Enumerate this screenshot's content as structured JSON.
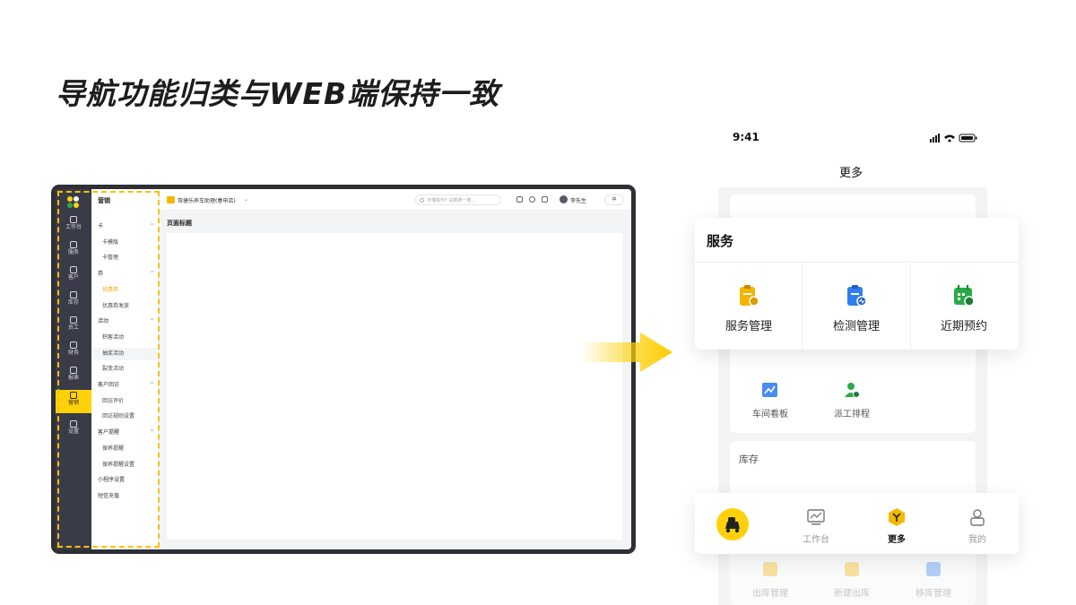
{
  "headline": "导航功能归类与WEB端保持一致",
  "web": {
    "rail": [
      {
        "label": "工作台",
        "icon": "workbench-icon"
      },
      {
        "label": "服务",
        "icon": "service-icon"
      },
      {
        "label": "客户",
        "icon": "customer-icon"
      },
      {
        "label": "库存",
        "icon": "inventory-icon"
      },
      {
        "label": "员工",
        "icon": "staff-icon"
      },
      {
        "label": "财务",
        "icon": "finance-icon"
      },
      {
        "label": "报表",
        "icon": "report-icon"
      },
      {
        "label": "营销",
        "icon": "marketing-icon",
        "active": true
      },
      {
        "label": "设置",
        "icon": "settings-icon"
      }
    ],
    "submenu": {
      "title": "营销",
      "rows": [
        {
          "label": "卡",
          "type": "group",
          "caret": "^"
        },
        {
          "label": "卡模版",
          "type": "child"
        },
        {
          "label": "卡管理",
          "type": "child"
        },
        {
          "label": "券",
          "type": "group",
          "caret": "^"
        },
        {
          "label": "优惠券",
          "type": "child",
          "active": true
        },
        {
          "label": "优惠券发放",
          "type": "child"
        },
        {
          "label": "活动",
          "type": "group",
          "caret": "^"
        },
        {
          "label": "积客活动",
          "type": "child"
        },
        {
          "label": "抽奖活动",
          "type": "child",
          "hover": true
        },
        {
          "label": "裂变活动",
          "type": "child"
        },
        {
          "label": "客户回访",
          "type": "group",
          "caret": "^"
        },
        {
          "label": "回访评价",
          "type": "child"
        },
        {
          "label": "回访规则设置",
          "type": "child"
        },
        {
          "label": "客户提醒",
          "type": "group",
          "caret": "^"
        },
        {
          "label": "保养提醒",
          "type": "child"
        },
        {
          "label": "保养提醒设置",
          "type": "child"
        },
        {
          "label": "小程序设置",
          "type": "group"
        },
        {
          "label": "短信充值",
          "type": "group"
        }
      ]
    },
    "topbar": {
      "shop": "驾捷乐养车助理(春申店)",
      "search_placeholder": "不懂操作? 试着搜一搜...",
      "user": "李先生",
      "lang": "中"
    },
    "page_title": "页面标题"
  },
  "phone": {
    "time": "9:41",
    "title": "更多",
    "services": {
      "title": "服务",
      "items": [
        {
          "label": "服务管理",
          "icon": "service-management-icon",
          "color": "#f5b400"
        },
        {
          "label": "检测管理",
          "icon": "inspection-management-icon",
          "color": "#2f7ff0"
        },
        {
          "label": "近期预约",
          "icon": "recent-appointment-icon",
          "color": "#2aa94a"
        }
      ]
    },
    "grid": [
      {
        "label": "车间看板",
        "icon": "workshop-board-icon"
      },
      {
        "label": "派工排程",
        "icon": "dispatch-schedule-icon"
      }
    ],
    "inventory_label": "库存",
    "faded": [
      {
        "label": "出库管理",
        "icon": "outbound-icon"
      },
      {
        "label": "新建出库",
        "icon": "new-outbound-icon"
      },
      {
        "label": "移库管理",
        "icon": "transfer-icon"
      }
    ],
    "tabs": [
      {
        "label": "",
        "icon": "scan-car-icon"
      },
      {
        "label": "工作台",
        "icon": "workbench-icon"
      },
      {
        "label": "更多",
        "icon": "more-icon",
        "active": true
      },
      {
        "label": "我的",
        "icon": "profile-icon"
      }
    ],
    "colors": {
      "accent": "#ffd10a",
      "rail": "#3a3b48"
    }
  }
}
